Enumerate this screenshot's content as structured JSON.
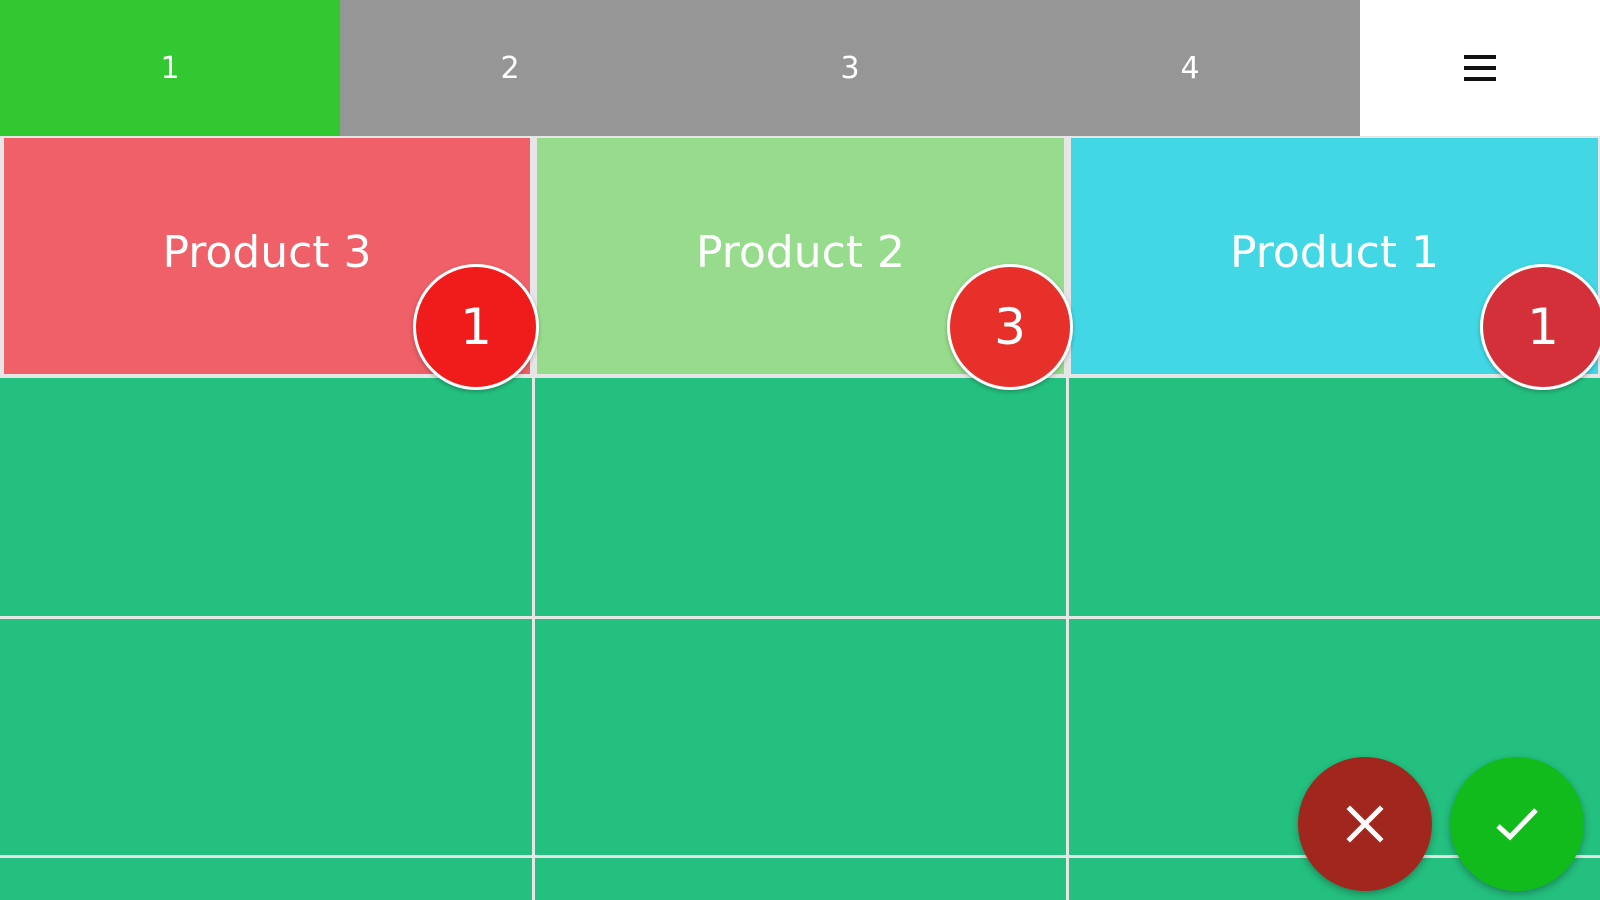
{
  "tabs": [
    {
      "label": "1",
      "active": true
    },
    {
      "label": "2",
      "active": false
    },
    {
      "label": "3",
      "active": false
    },
    {
      "label": "4",
      "active": false
    }
  ],
  "menu": {
    "icon": "hamburger-menu-icon"
  },
  "products": [
    {
      "name": "Product 3",
      "quantity": "1",
      "color": "#ef6068",
      "badge_color": "#f01c1c"
    },
    {
      "name": "Product 2",
      "quantity": "3",
      "color": "#97dc8c",
      "badge_color": "#e8302a"
    },
    {
      "name": "Product 1",
      "quantity": "1",
      "color": "#42d7e4",
      "badge_color": "#d3303a"
    }
  ],
  "actions": {
    "cancel_icon": "close-icon",
    "confirm_icon": "check-icon",
    "cancel_color": "#a1271e",
    "confirm_color": "#12bb1c"
  },
  "colors": {
    "tab_active": "#32c832",
    "tab_inactive": "#969696",
    "grid_background": "#24c07f",
    "grid_lines": "#e6e6e6"
  }
}
